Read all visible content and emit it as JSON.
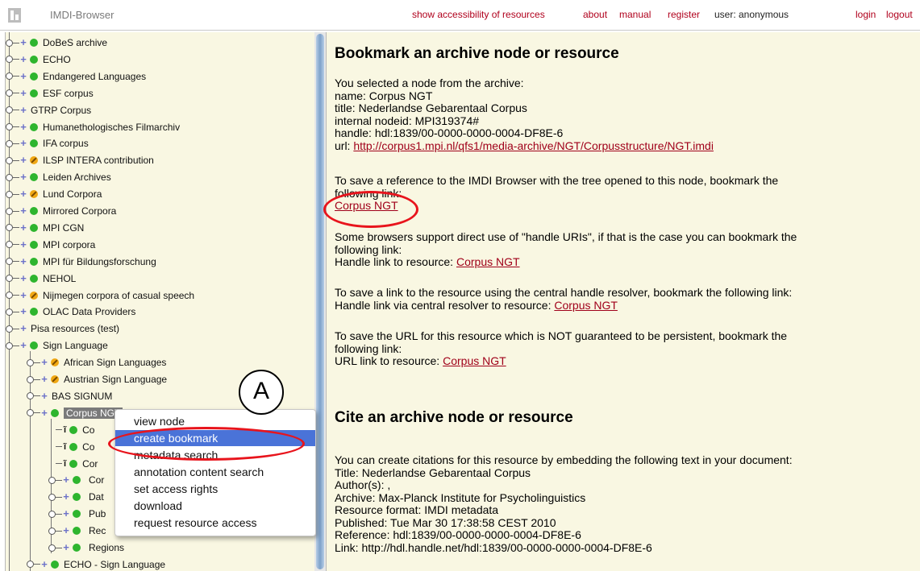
{
  "header": {
    "app_title": "IMDI-Browser",
    "links": {
      "accessibility": "show accessibility of resources",
      "about": "about",
      "manual": "manual",
      "register": "register",
      "user": "user: anonymous",
      "login": "login",
      "logout": "logout"
    }
  },
  "tree": {
    "items": [
      {
        "label": "DoBeS archive",
        "icon": "green"
      },
      {
        "label": "ECHO",
        "icon": "green"
      },
      {
        "label": "Endangered Languages",
        "icon": "green"
      },
      {
        "label": "ESF corpus",
        "icon": "green"
      },
      {
        "label": "GTRP Corpus",
        "icon": "none"
      },
      {
        "label": "Humanethologisches Filmarchiv",
        "icon": "green"
      },
      {
        "label": "IFA corpus",
        "icon": "green"
      },
      {
        "label": "ILSP INTERA contribution",
        "icon": "orange"
      },
      {
        "label": "Leiden Archives",
        "icon": "green"
      },
      {
        "label": "Lund Corpora",
        "icon": "orange"
      },
      {
        "label": "Mirrored Corpora",
        "icon": "green"
      },
      {
        "label": "MPI CGN",
        "icon": "green"
      },
      {
        "label": "MPI corpora",
        "icon": "green"
      },
      {
        "label": "MPI für Bildungsforschung",
        "icon": "green"
      },
      {
        "label": "NEHOL",
        "icon": "green"
      },
      {
        "label": "Nijmegen corpora of casual speech",
        "icon": "orange"
      },
      {
        "label": "OLAC Data Providers",
        "icon": "green"
      },
      {
        "label": "Pisa resources (test)",
        "icon": "none"
      },
      {
        "label": "Sign Language",
        "icon": "green"
      }
    ],
    "sign_children": [
      {
        "label": "African Sign Languages",
        "icon": "orange"
      },
      {
        "label": "Austrian Sign Language",
        "icon": "orange"
      },
      {
        "label": "BAS SIGNUM",
        "icon": "none"
      },
      {
        "label": "Corpus NGT",
        "icon": "green"
      }
    ],
    "ngt_children": [
      {
        "label": "Co",
        "type": "user"
      },
      {
        "label": "Co",
        "type": "user"
      },
      {
        "label": "Cor",
        "type": "user"
      },
      {
        "label": "Cor",
        "type": "plus"
      },
      {
        "label": "Dat",
        "type": "plus"
      },
      {
        "label": "Pub",
        "type": "plus"
      },
      {
        "label": "Rec",
        "type": "plus"
      },
      {
        "label": "Regions",
        "type": "plus"
      }
    ],
    "last_item": {
      "label": "ECHO - Sign Language",
      "icon": "green"
    }
  },
  "context_menu": {
    "items": [
      "view node",
      "create bookmark",
      "metadata search",
      "annotation content search",
      "set access rights",
      "download",
      "request resource access"
    ],
    "highlighted": 1
  },
  "annotation_label": "A",
  "content": {
    "bookmark_heading": "Bookmark an archive node or resource",
    "selected_intro": "You selected a node from the archive:",
    "name_line": "name: Corpus NGT",
    "title_line": "title: Nederlandse Gebarentaal Corpus",
    "nodeid_line": "internal nodeid: MPI319374#",
    "handle_line": "handle: hdl:1839/00-0000-0000-0004-DF8E-6",
    "url_prefix": "url: ",
    "url_link": "http://corpus1.mpi.nl/qfs1/media-archive/NGT/Corpusstructure/NGT.imdi",
    "save_ref_1": "To save a reference to the IMDI Browser with the tree opened to this node, bookmark the",
    "save_ref_2": "following link:",
    "link_corpus": "Corpus NGT",
    "handle_uri_1": "Some browsers support direct use of \"handle URIs\", if that is the case you can bookmark the",
    "handle_uri_2": "following link:",
    "handle_uri_3": "Handle link to resource: ",
    "central_1": "To save a link to the resource using the central handle resolver, bookmark the following link:",
    "central_2": "Handle link via central resolver to resource: ",
    "url_save_1": "To save the URL for this resource which is NOT guaranteed to be persistent, bookmark the",
    "url_save_2": "following link:",
    "url_save_3": "URL link to resource: ",
    "cite_heading": "Cite an archive node or resource",
    "cite_1": "You can create citations for this resource by embedding the following text in your document:",
    "cite_title": "Title: Nederlandse Gebarentaal Corpus",
    "cite_author": "Author(s): ,",
    "cite_archive": "Archive: Max-Planck Institute for Psycholinguistics",
    "cite_format": "Resource format: IMDI metadata",
    "cite_published": "Published: Tue Mar 30 17:38:58 CEST 2010",
    "cite_reference": "Reference: hdl:1839/00-0000-0000-0004-DF8E-6",
    "cite_link": "Link: http://hdl.handle.net/hdl:1839/00-0000-0000-0004-DF8E-6"
  },
  "colors": {
    "link": "#a0001a",
    "highlight": "#4a73d8",
    "annotation": "#e8141c",
    "background": "#f9f7e2"
  }
}
